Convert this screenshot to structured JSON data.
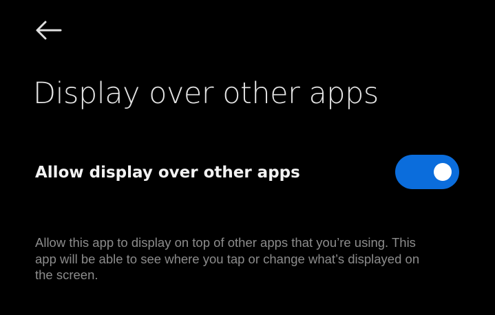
{
  "header": {
    "back_icon": "arrow-left-icon",
    "title": "Display over other apps"
  },
  "setting": {
    "label": "Allow display over other apps",
    "enabled": true,
    "toggle_color": "#0b6ddc"
  },
  "description": {
    "text": "Allow this app to display on top of other apps that you’re using. This app will be able to see where you tap or change what’s displayed on the screen."
  },
  "colors": {
    "background": "#000000",
    "title": "#e4e4e4",
    "label": "#f2f2f2",
    "description": "#8c8c8c"
  }
}
